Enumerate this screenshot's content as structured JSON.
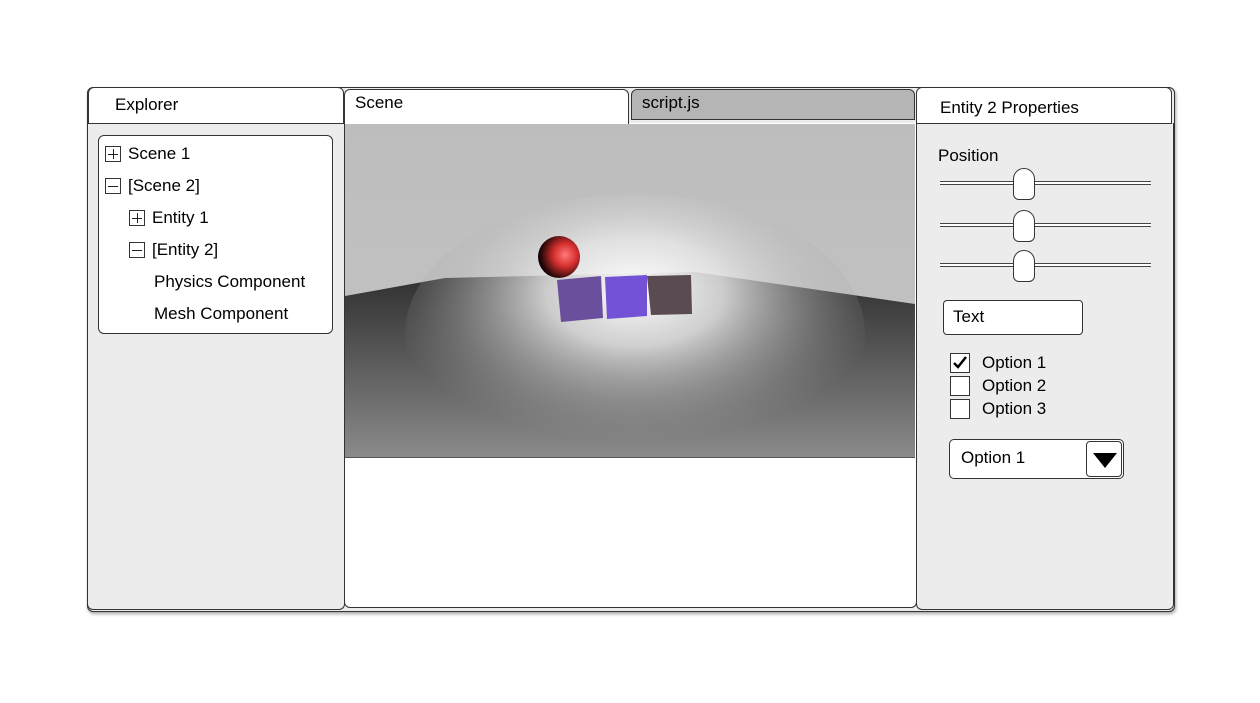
{
  "explorer": {
    "title": "Explorer",
    "tree": [
      {
        "label": "Scene 1",
        "toggle": "plus"
      },
      {
        "label": "[Scene 2]",
        "toggle": "minus"
      },
      {
        "label": "Entity 1",
        "toggle": "plus"
      },
      {
        "label": "[Entity 2]",
        "toggle": "minus"
      },
      {
        "label": "Physics Component",
        "toggle": "none"
      },
      {
        "label": "Mesh Component",
        "toggle": "none"
      }
    ]
  },
  "tabs": [
    {
      "label": "Scene",
      "active": true
    },
    {
      "label": "script.js",
      "active": false
    }
  ],
  "viewport": {
    "sky_color": "#b9b9b9",
    "floor_color": "#3a3a3a",
    "sphere_color": "#e23a3a",
    "cube_colors": [
      "#6a4f9c",
      "#7352d6",
      "#5a4a52"
    ]
  },
  "properties": {
    "title": "Entity 2 Properties",
    "position_label": "Position",
    "sliders": [
      {
        "name": "position-x",
        "value": 0.4
      },
      {
        "name": "position-y",
        "value": 0.4
      },
      {
        "name": "position-z",
        "value": 0.4
      }
    ],
    "text_value": "Text",
    "checkboxes": [
      {
        "label": "Option 1",
        "checked": true
      },
      {
        "label": "Option 2",
        "checked": false
      },
      {
        "label": "Option 3",
        "checked": false
      }
    ],
    "select_value": "Option 1"
  }
}
